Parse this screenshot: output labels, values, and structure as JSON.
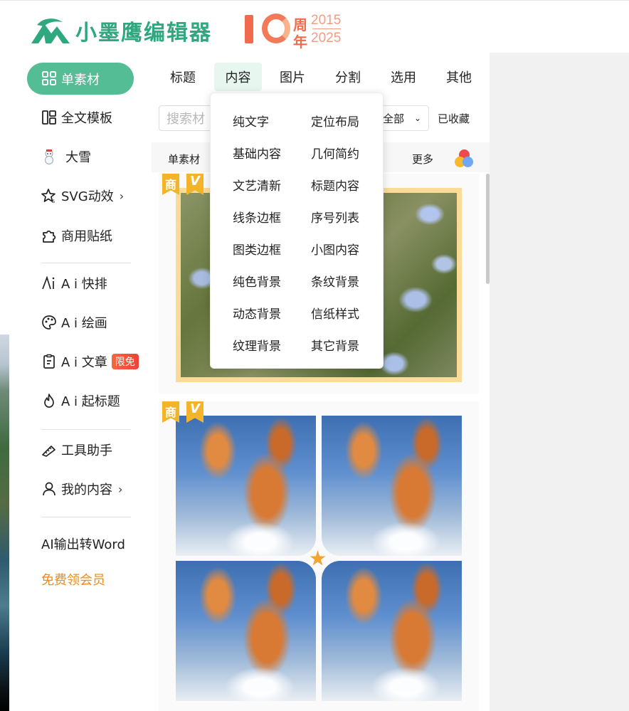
{
  "header": {
    "logo_text": "小墨鹰编辑器",
    "anniversary": {
      "number": "10",
      "zhou": "周",
      "nian": "年",
      "year_start": "2015",
      "year_end": "2025"
    }
  },
  "sidebar": {
    "items": [
      {
        "label": "单素材",
        "icon": "grid-icon",
        "active": true
      },
      {
        "label": "全文模板",
        "icon": "layout-icon"
      },
      {
        "label": "大雪",
        "icon": "snowman-icon"
      },
      {
        "label": "SVG动效",
        "icon": "star-sparkle-icon",
        "chevron": "›"
      },
      {
        "label": "商用贴纸",
        "icon": "puzzle-icon"
      },
      {
        "label": "A i 快排",
        "icon": "ai-icon"
      },
      {
        "label": "A i 绘画",
        "icon": "palette-icon"
      },
      {
        "label": "A i 文章",
        "icon": "document-icon",
        "badge": "限免"
      },
      {
        "label": "A i 起标题",
        "icon": "flame-icon"
      },
      {
        "label": "工具助手",
        "icon": "ruler-icon"
      },
      {
        "label": "我的内容",
        "icon": "user-icon",
        "chevron": "›"
      },
      {
        "label": "AI输出转Word"
      },
      {
        "label": "免费领会员"
      }
    ]
  },
  "tabs": [
    "标题",
    "内容",
    "图片",
    "分割",
    "选用",
    "其他"
  ],
  "search": {
    "placeholder": "搜索材"
  },
  "filter": {
    "selected": "全部",
    "favorites": "已收藏"
  },
  "subbar": {
    "left": "单素材",
    "more": "更多"
  },
  "cards": {
    "badge_commercial": "商",
    "badge_vip": "V"
  },
  "dropdown": {
    "items": [
      [
        "纯文字",
        "定位布局"
      ],
      [
        "基础内容",
        "几何简约"
      ],
      [
        "文艺清新",
        "标题内容"
      ],
      [
        "线条边框",
        "序号列表"
      ],
      [
        "图类边框",
        "小图内容"
      ],
      [
        "纯色背景",
        "条纹背景"
      ],
      [
        "动态背景",
        "信纸样式"
      ],
      [
        "纹理背景",
        "其它背景"
      ]
    ]
  },
  "colors": {
    "brand_green": "#2fa77f",
    "active_pill": "#54bd96",
    "promo_orange": "#f08a1c",
    "badge_red": "#f04b3a",
    "badge_gold": "#f2b428"
  }
}
